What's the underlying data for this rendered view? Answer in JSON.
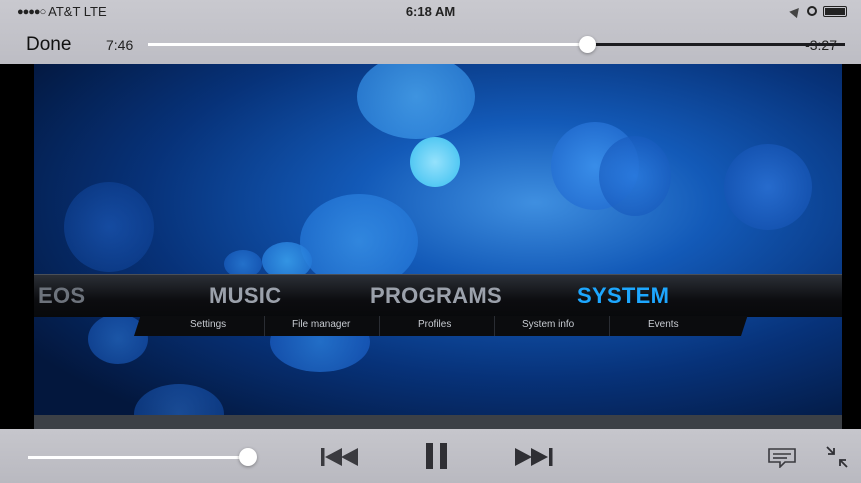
{
  "status_bar": {
    "carrier": "AT&T",
    "signal_dots": "●●●●○",
    "network": "LTE",
    "time": "6:18 AM"
  },
  "player": {
    "done_label": "Done",
    "elapsed": "7:46",
    "remaining": "-3:27",
    "progress_fraction": 0.63,
    "volume_fraction": 1.0
  },
  "video": {
    "main_menu": [
      "EOS",
      "MUSIC",
      "PROGRAMS",
      "SYSTEM"
    ],
    "active_menu": "SYSTEM",
    "submenu": [
      "Settings",
      "File manager",
      "Profiles",
      "System info",
      "Events"
    ]
  },
  "icons": {
    "previous": "skip-back-icon",
    "pause": "pause-icon",
    "next": "skip-forward-icon",
    "subtitles": "subtitles-icon",
    "exit_fullscreen": "exit-fullscreen-icon"
  },
  "colors": {
    "active_menu": "#1da7ff",
    "bar_background": "#c3c3c9"
  }
}
